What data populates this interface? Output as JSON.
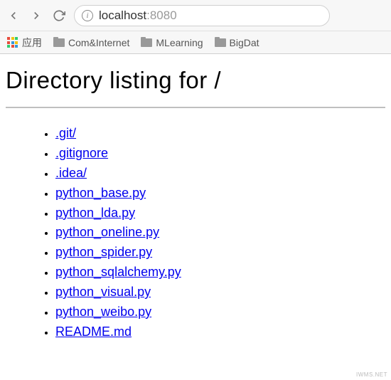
{
  "url": {
    "host": "localhost",
    "port": ":8080"
  },
  "bookmarks": {
    "apps_label": "应用",
    "folders": [
      {
        "label": "Com&Internet"
      },
      {
        "label": "MLearning"
      },
      {
        "label": "BigDat"
      }
    ]
  },
  "page": {
    "title": "Directory listing for /",
    "entries": [
      ".git/",
      ".gitignore",
      ".idea/",
      "python_base.py",
      "python_lda.py",
      "python_oneline.py",
      "python_spider.py",
      "python_sqlalchemy.py",
      "python_visual.py",
      "python_weibo.py",
      "README.md"
    ]
  },
  "watermark": "IWMS.NET"
}
